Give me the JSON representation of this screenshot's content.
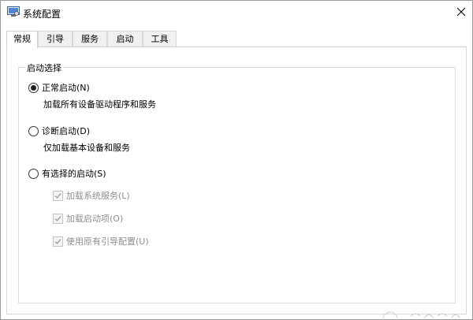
{
  "window": {
    "title": "系统配置",
    "icon": "msconfig-icon"
  },
  "tabs": [
    {
      "label": "常规",
      "active": true
    },
    {
      "label": "引导",
      "active": false
    },
    {
      "label": "服务",
      "active": false
    },
    {
      "label": "启动",
      "active": false
    },
    {
      "label": "工具",
      "active": false
    }
  ],
  "startup": {
    "group_label": "启动选择",
    "options": [
      {
        "label": "正常启动(N)",
        "desc": "加载所有设备驱动程序和服务",
        "selected": true
      },
      {
        "label": "诊断启动(D)",
        "desc": "仅加载基本设备和服务",
        "selected": false
      },
      {
        "label": "有选择的启动(S)",
        "desc": "",
        "selected": false
      }
    ],
    "selective": [
      {
        "label": "加载系统服务(L)",
        "checked": true,
        "enabled": false
      },
      {
        "label": "加载启动项(O)",
        "checked": true,
        "enabled": false
      },
      {
        "label": "使用原有引导配置(U)",
        "checked": true,
        "enabled": false
      }
    ]
  },
  "colors": {
    "disabled_text": "#8f8f8f",
    "border": "#dcdcdc"
  }
}
